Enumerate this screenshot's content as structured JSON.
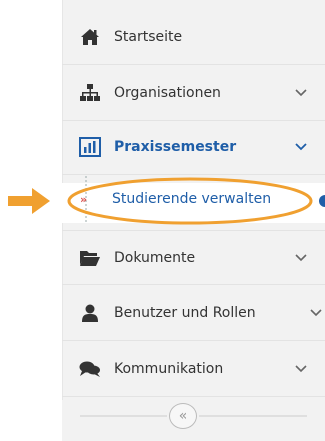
{
  "colors": {
    "accent": "#1f5ea8",
    "annotation_orange": "#f0a030",
    "text": "#333333",
    "sidebar_bg": "#f2f2f2"
  },
  "nav": {
    "items": [
      {
        "label": "Startseite",
        "icon": "home-icon",
        "has_chevron": false
      },
      {
        "label": "Organisationen",
        "icon": "sitemap-icon",
        "has_chevron": true
      },
      {
        "label": "Praxissemester",
        "icon": "bar-chart-icon",
        "has_chevron": true,
        "active": true
      },
      {
        "label": "Dokumente",
        "icon": "folder-open-icon",
        "has_chevron": true
      },
      {
        "label": "Benutzer und Rollen",
        "icon": "user-icon",
        "has_chevron": true
      },
      {
        "label": "Kommunikation",
        "icon": "comments-icon",
        "has_chevron": true
      }
    ],
    "subitem": {
      "label": "Studierende verwalten",
      "marker": "»"
    },
    "collapse": {
      "icon": "double-chevron-left-icon",
      "glyph": "«"
    }
  }
}
